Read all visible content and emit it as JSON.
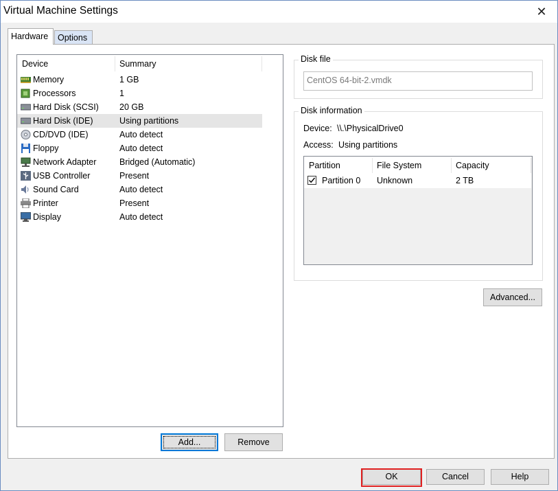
{
  "window": {
    "title": "Virtual Machine Settings"
  },
  "tabs": [
    {
      "label": "Hardware"
    },
    {
      "label": "Options"
    }
  ],
  "device_list": {
    "columns": [
      "Device",
      "Summary"
    ],
    "rows": [
      {
        "icon": "memory-icon",
        "device": "Memory",
        "summary": "1 GB"
      },
      {
        "icon": "processor-icon",
        "device": "Processors",
        "summary": "1"
      },
      {
        "icon": "hard-disk-icon",
        "device": "Hard Disk (SCSI)",
        "summary": "20 GB"
      },
      {
        "icon": "hard-disk-icon",
        "device": "Hard Disk (IDE)",
        "summary": "Using partitions",
        "selected": true
      },
      {
        "icon": "cd-dvd-icon",
        "device": "CD/DVD (IDE)",
        "summary": "Auto detect"
      },
      {
        "icon": "floppy-icon",
        "device": "Floppy",
        "summary": "Auto detect"
      },
      {
        "icon": "network-adapter-icon",
        "device": "Network Adapter",
        "summary": "Bridged (Automatic)"
      },
      {
        "icon": "usb-icon",
        "device": "USB Controller",
        "summary": "Present"
      },
      {
        "icon": "sound-card-icon",
        "device": "Sound Card",
        "summary": "Auto detect"
      },
      {
        "icon": "printer-icon",
        "device": "Printer",
        "summary": "Present"
      },
      {
        "icon": "display-icon",
        "device": "Display",
        "summary": "Auto detect"
      }
    ]
  },
  "buttons": {
    "add": "Add...",
    "remove": "Remove",
    "advanced": "Advanced...",
    "ok": "OK",
    "cancel": "Cancel",
    "help": "Help"
  },
  "disk_file": {
    "label": "Disk file",
    "value": "CentOS 64-bit-2.vmdk"
  },
  "disk_info": {
    "label": "Disk information",
    "device_label": "Device:",
    "device_value": "\\\\.\\PhysicalDrive0",
    "access_label": "Access:",
    "access_value": "Using partitions",
    "columns": [
      "Partition",
      "File System",
      "Capacity"
    ],
    "partitions": [
      {
        "name": "Partition 0",
        "checked": true,
        "file_system": "Unknown",
        "capacity": "2 TB"
      }
    ]
  },
  "colors": {
    "selection": "#e5e5e5",
    "ok_highlight": "#e02020",
    "focus_border": "#0078d7"
  }
}
